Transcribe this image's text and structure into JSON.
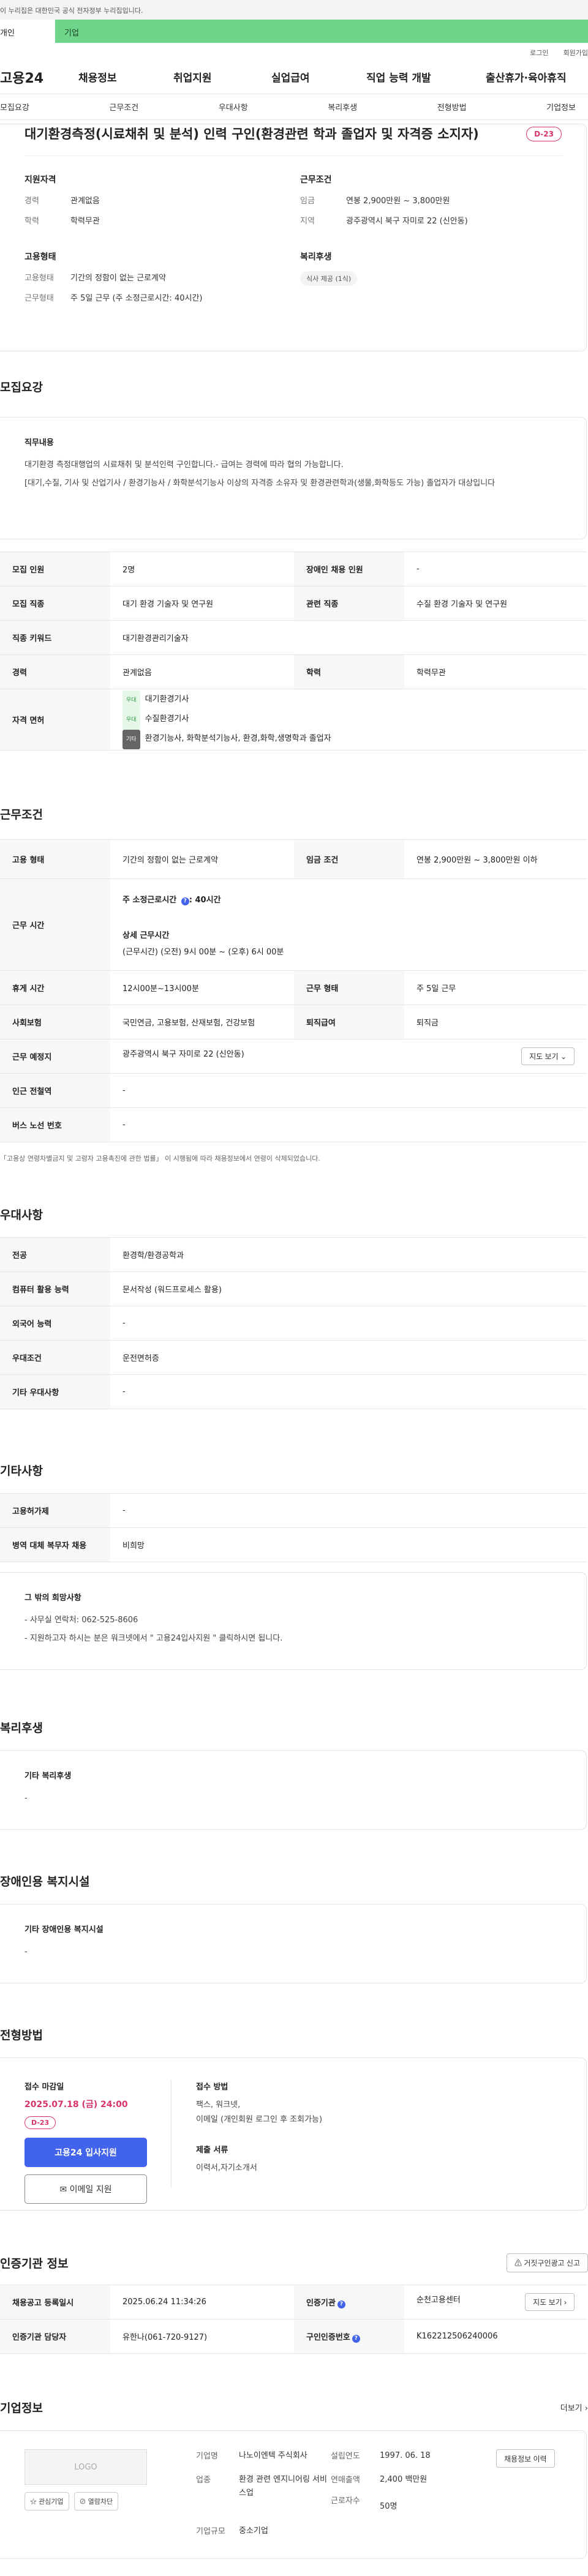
{
  "gov_banner": "이 누리집은 대한민국 공식 전자정부 누리집입니다.",
  "top_tabs": {
    "personal": "개인",
    "company": "기업"
  },
  "util": {
    "login": "로그인",
    "signup": "회원가입"
  },
  "gnb": {
    "logo": "고용24",
    "items": [
      "채용정보",
      "취업지원",
      "실업급여",
      "직업 능력 개발",
      "출산휴가·육아휴직"
    ]
  },
  "anchor_tabs": [
    "모집요강",
    "근무조건",
    "우대사항",
    "복리후생",
    "전형방법",
    "기업정보"
  ],
  "summary": {
    "title": "대기환경측정(시료채취 및 분석) 인력 구인(환경관련 학과 졸업자 및 자격증 소지자)",
    "dday": "D-23",
    "qualification_title": "지원자격",
    "career_key": "경력",
    "career_val": "관계없음",
    "edu_key": "학력",
    "edu_val": "학력무관",
    "conditions_title": "근무조건",
    "wage_key": "임금",
    "wage_val": "연봉 2,900만원 ~ 3,800만원",
    "region_key": "지역",
    "region_val": "광주광역시 북구 자미로 22 (신안동)",
    "employment_title": "고용형태",
    "emp_key": "고용형태",
    "emp_val": "기간의 정함이 없는 근로계약",
    "work_key": "근무형태",
    "work_val": "주 5일 근무 (주 소정근로시간: 40시간)",
    "welfare_title": "복리후생",
    "welfare_chip": "식사 제공 (1식)"
  },
  "recruit": {
    "section_title": "모집요강",
    "duty_title": "직무내용",
    "duty_p1": "대기환경 측정대행업의 시료채취 및 분석인력 구인합니다.- 급여는 경력에 따라 협의 가능합니다.",
    "duty_p2": "[대기,수질, 기사 및 산업기사 / 환경기능사 / 화학분석기능사 이상의 자격증 소유자 및 환경관련학과(생물,화학등도 가능) 졸업자가 대상입니다",
    "rows": {
      "count_k": "모집 인원",
      "count_v": "2명",
      "disabled_k": "장애인 채용 인원",
      "disabled_v": "-",
      "job_k": "모집 직종",
      "job_v": "대기 환경 기술자 및 연구원",
      "related_k": "관련 직종",
      "related_v": "수질 환경 기술자 및 연구원",
      "keyword_k": "직종 키워드",
      "keyword_v": "대기환경관리기술자",
      "career_k": "경력",
      "career_v": "관계없음",
      "edu_k": "학력",
      "edu_v": "학력무관",
      "license_k": "자격 면허",
      "license_tag1": "우대",
      "license_1": "대기환경기사",
      "license_tag2": "우대",
      "license_2": "수질환경기사",
      "license_tag3": "기타",
      "license_3": "환경기능사, 화학분석기능사, 환경,화학,생명학과 졸업자"
    }
  },
  "conditions": {
    "section_title": "근무조건",
    "emp_k": "고용 형태",
    "emp_v": "기간의 정함이 없는 근로계약",
    "wage_k": "임금 조건",
    "wage_v": "연봉 2,900만원 ~ 3,800만원 이하",
    "hours_k": "근무 시간",
    "hours_prescribed": "주 소정근로시간 ",
    "hours_q": "?",
    "hours_prescribed_val": ": 40시간",
    "hours_detail_title": "상세 근무시간",
    "hours_detail": "(근무시간) (오전) 9시 00분 ~ (오후) 6시 00분",
    "break_k": "휴게 시간",
    "break_v": "12시00분~13시00분",
    "worktype_k": "근무 형태",
    "worktype_v": "주 5일 근무",
    "insurance_k": "사회보험",
    "insurance_v": "국민연금, 고용보험, 산재보험, 건강보험",
    "retire_k": "퇴직급여",
    "retire_v": "퇴직금",
    "place_k": "근무 예정지",
    "place_v": "광주광역시 북구 자미로 22 (신안동)",
    "map_btn": "지도 보기",
    "subway_k": "인근 전철역",
    "subway_v": "-",
    "bus_k": "버스 노선 번호",
    "bus_v": "-",
    "note": "「고용상 연령차별금지 및 고령자 고용촉진에 관한 법률」 이 시행됨에 따라 채용정보에서 연령이 삭제되었습니다."
  },
  "preference": {
    "section_title": "우대사항",
    "major_k": "전공",
    "major_v": "환경학/환경공학과",
    "computer_k": "컴퓨터 활용 능력",
    "computer_v": "문서작성 (워드프로세스 활용)",
    "lang_k": "외국어 능력",
    "lang_v": "-",
    "cond_k": "우대조건",
    "cond_v": "운전면허증",
    "etc_k": "기타 우대사항",
    "etc_v": "-"
  },
  "other": {
    "section_title": "기타사항",
    "visa_k": "고용허가제",
    "visa_v": "-",
    "military_k": "병역 대체 복무자 채용",
    "military_v": "비희망",
    "extra_title": "그 밖의 희망사항",
    "extra_1": "- 사무실 연락처: 062-525-8606",
    "extra_2": "- 지원하고자 하시는 분은  워크넷에서 \" 고용24입사지원 \" 클릭하시면 됩니다."
  },
  "welfare": {
    "section_title": "복리후생",
    "sub_title": "기타 복리후생",
    "value": "-"
  },
  "disabled_facility": {
    "section_title": "장애인용 복지시설",
    "sub_title": "기타 장애인용 복지시설",
    "value": "-"
  },
  "apply": {
    "section_title": "전형방법",
    "deadline_label": "접수 마감일",
    "deadline": "2025.07.18 (금) 24:00",
    "dday": "D-23",
    "apply_btn": "고용24 입사지원",
    "email_btn": "이메일 지원",
    "method_label": "접수 방법",
    "method_1": "팩스, 워크넷,",
    "method_2": "이메일 (개인회원 로그인 후 조회가능)",
    "docs_label": "제출 서류",
    "docs": "이력서,자기소개서"
  },
  "agency": {
    "section_title": "인증기관 정보",
    "report_btn": "거짓구인광고 신고",
    "reg_k": "채용공고 등록일시",
    "reg_v": "2025.06.24 11:34:26",
    "org_k": "인증기관",
    "org_v": "순천고용센터",
    "manager_k": "인증기관 담당자",
    "manager_v": "유한나(061-720-9127)",
    "num_k": "구인인증번호",
    "num_v": "K162212506240006",
    "map_btn": "지도 보기"
  },
  "company": {
    "section_title": "기업정보",
    "more": "더보기",
    "logo": "LOGO",
    "fav_btn": "관심기업",
    "block_btn": "열람차단",
    "name_k": "기업명",
    "name_v": "나노이엔텍 주식회사",
    "founded_k": "설립연도",
    "founded_v": "1997. 06. 18",
    "industry_k": "업종",
    "industry_v": "환경 관련 엔지니어링 서비스업",
    "sales_k": "연매출액",
    "sales_v": "2,400 백만원",
    "staff_k": "근로자수",
    "staff_v": "50명",
    "size_k": "기업규모",
    "size_v": "중소기업",
    "history_btn": "채용정보 이력"
  }
}
